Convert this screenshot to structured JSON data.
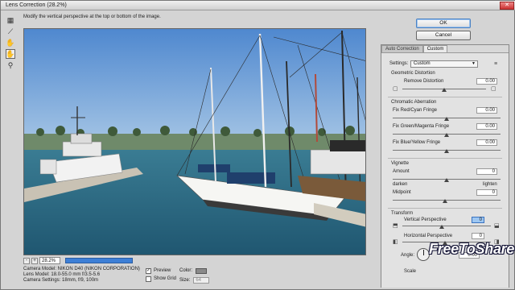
{
  "window": {
    "title": "Lens Correction (28.2%)"
  },
  "hint": "Modify the vertical perspective at the top or bottom of the image.",
  "buttons": {
    "ok": "OK",
    "cancel": "Cancel"
  },
  "tools": [
    "remove-distortion-tool",
    "straighten-tool",
    "move-grid-tool",
    "hand-tool",
    "zoom-tool"
  ],
  "tabs": [
    {
      "label": "Auto Correction"
    },
    {
      "label": "Custom"
    }
  ],
  "settings": {
    "label": "Settings:",
    "value": "Custom"
  },
  "geometric": {
    "title": "Geometric Distortion",
    "remove_label": "Remove Distortion",
    "remove_value": "0.00"
  },
  "chromatic": {
    "title": "Chromatic Aberration",
    "red_cyan_label": "Fix Red/Cyan Fringe",
    "red_cyan_value": "0.00",
    "green_magenta_label": "Fix Green/Magenta Fringe",
    "green_magenta_value": "0.00",
    "blue_yellow_label": "Fix Blue/Yellow Fringe",
    "blue_yellow_value": "0.00"
  },
  "vignette": {
    "title": "Vignette",
    "amount_label": "Amount",
    "amount_value": "0",
    "darken": "darken",
    "lighten": "lighten",
    "midpoint_label": "Midpoint",
    "midpoint_value": "0"
  },
  "transform": {
    "title": "Transform",
    "vertical_label": "Vertical Perspective",
    "vertical_value": "0",
    "horizontal_label": "Horizontal Perspective",
    "horizontal_value": "0",
    "angle_label": "Angle:",
    "angle_value": "0.00",
    "scale_label": "Scale"
  },
  "preview": {
    "zoom_minus": "-",
    "zoom_plus": "+",
    "zoom_value": "28.2%",
    "camera_model": "Camera Model: NIKON D40 (NIKON CORPORATION)",
    "lens_model": "Lens Model: 18.0-55.0 mm f/3.5-5.6",
    "camera_settings": "Camera Settings: 18mm, f/9, 100m",
    "preview_label": "Preview",
    "show_grid_label": "Show Grid",
    "color_label": "Color:",
    "size_label": "Size:",
    "size_value": "64"
  },
  "watermark": "FreeToShare",
  "colors": {
    "sky": "#5a92d4",
    "water": "#2f6a86",
    "panel": "#e2e2e2",
    "accent": "#3d7fd6"
  }
}
